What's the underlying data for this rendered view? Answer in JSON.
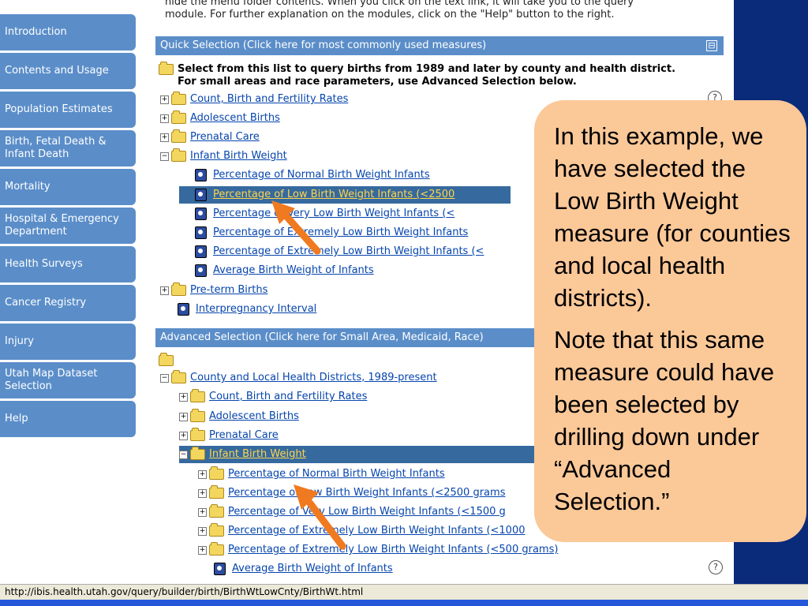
{
  "intro_text": "module. For further explanation on the modules, click on the \"Help\" button to the right.",
  "intro_partial": "hide the menu folder contents. When you click on the text link, it will take you to the query",
  "sidebar": {
    "items": [
      {
        "label": "Introduction"
      },
      {
        "label": "Contents and Usage"
      },
      {
        "label": "Population Estimates"
      },
      {
        "label": "Birth, Fetal Death & Infant Death"
      },
      {
        "label": "Mortality"
      },
      {
        "label": "Hospital & Emergency Department"
      },
      {
        "label": "Health Surveys"
      },
      {
        "label": "Cancer Registry"
      },
      {
        "label": "Injury"
      },
      {
        "label": "Utah Map Dataset Selection"
      },
      {
        "label": "Help"
      }
    ]
  },
  "quick_selection": {
    "header": "Quick Selection (Click here for most commonly used measures)",
    "collapse_symbol": "⊟",
    "description_line1": "Select from this list to query births from 1989 and later by county and health district.",
    "description_line2": "For small areas and race parameters, use Advanced Selection below.",
    "items": {
      "count": "Count, Birth and Fertility Rates",
      "adolescent": "Adolescent Births",
      "prenatal": "Prenatal Care",
      "infant_weight": "Infant Birth Weight",
      "normal": "Percentage of Normal Birth Weight Infants",
      "low": "Percentage of Low Birth Weight Infants (<2500",
      "very_low": "Percentage of Very Low Birth Weight Infants (<",
      "extremely_low_1": "Percentage of Extremely Low Birth Weight Infants",
      "extremely_low_2": "Percentage of Extremely Low Birth Weight Infants (<",
      "average": "Average Birth Weight of Infants",
      "preterm": "Pre-term Births",
      "interpregnancy": "Interpregnancy Interval"
    }
  },
  "advanced_selection": {
    "header": "Advanced Selection (Click here for Small Area, Medicaid, Race)",
    "items": {
      "county": "County and Local Health Districts, 1989-present",
      "count": "Count, Birth and Fertility Rates",
      "adolescent": "Adolescent Births",
      "prenatal": "Prenatal Care",
      "infant_weight": "Infant Birth Weight",
      "normal": "Percentage of Normal Birth Weight Infants",
      "low": "Percentage of Low Birth Weight Infants (<2500 grams",
      "very_low": "Percentage of Very Low Birth Weight Infants (<1500 g",
      "extremely_low_1": "Percentage of Extremely Low Birth Weight Infants (<1000",
      "extremely_low_2": "Percentage of Extremely Low Birth Weight Infants (<500 grams)",
      "average": "Average Birth Weight of Infants"
    }
  },
  "help_symbol": "?",
  "callout": {
    "para1": "In this example, we have selected the Low Birth Weight measure (for counties and local health districts).",
    "para2": "Note that this same measure could have been selected by drilling down under “Advanced Selection.”"
  },
  "status_url": "http://ibis.health.utah.gov/query/builder/birth/BirthWtLowCnty/BirthWt.html",
  "colors": {
    "nav_blue": "#5b8ec9",
    "selected_row": "#366a9f",
    "callout_bg": "#fbc898",
    "arrow": "#f07a20"
  }
}
